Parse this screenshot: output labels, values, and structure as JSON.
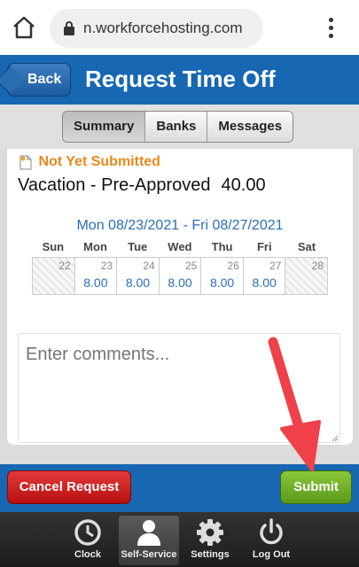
{
  "browser": {
    "url": "n.workforcehosting.com"
  },
  "header": {
    "back_label": "Back",
    "title": "Request Time Off"
  },
  "tabs": [
    {
      "label": "Summary",
      "active": true
    },
    {
      "label": "Banks",
      "active": false
    },
    {
      "label": "Messages",
      "active": false
    }
  ],
  "request": {
    "status": "Not Yet Submitted",
    "type": "Vacation - Pre-Approved",
    "hours": "40.00",
    "date_range": "Mon 08/23/2021 - Fri 08/27/2021"
  },
  "calendar": {
    "days": [
      "Sun",
      "Mon",
      "Tue",
      "Wed",
      "Thu",
      "Fri",
      "Sat"
    ],
    "dates": [
      "22",
      "23",
      "24",
      "25",
      "26",
      "27",
      "28"
    ],
    "hours": [
      "",
      "8.00",
      "8.00",
      "8.00",
      "8.00",
      "8.00",
      ""
    ]
  },
  "comments": {
    "placeholder": "Enter comments..."
  },
  "actions": {
    "cancel_label": "Cancel Request",
    "submit_label": "Submit"
  },
  "bottom_nav": [
    {
      "label": "Clock",
      "icon": "clock-icon"
    },
    {
      "label": "Self-Service",
      "icon": "person-icon",
      "active": true
    },
    {
      "label": "Settings",
      "icon": "gear-icon"
    },
    {
      "label": "Log Out",
      "icon": "power-icon"
    }
  ],
  "colors": {
    "header_blue": "#1767b3",
    "status_orange": "#e68a1e",
    "cancel_red": "#c81e1e",
    "submit_green": "#6fae26",
    "arrow_red": "#f0404a"
  }
}
